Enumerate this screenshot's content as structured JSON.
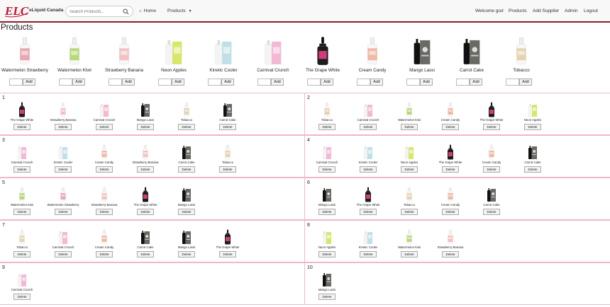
{
  "brand": {
    "logo_text": "ELC",
    "name": "eLiquid Canada"
  },
  "search": {
    "placeholder": "Search Products..."
  },
  "nav": {
    "home": "Home",
    "products": "Products",
    "welcome": "Welcome god",
    "right_products": "Products",
    "add_supplier": "Add Supplier",
    "admin": "Admin",
    "logout": "Logout"
  },
  "page_title": "Products",
  "add_label": "Add",
  "delete_label": "Delete",
  "products": [
    {
      "name": "Watermelon Strawberry",
      "key": "watermelon_strawberry"
    },
    {
      "name": "Watermelon KIwI",
      "key": "watermelon_kiwi"
    },
    {
      "name": "Strawberry Banana",
      "key": "strawberry_banana"
    },
    {
      "name": "Neon Apples",
      "key": "neon_apples"
    },
    {
      "name": "Kinetic Cooler",
      "key": "kinetic_cooler"
    },
    {
      "name": "Carnival Crunch",
      "key": "carnival_crunch"
    },
    {
      "name": "The Grape White",
      "key": "grape_white"
    },
    {
      "name": "Cream Candy",
      "key": "cream_candy"
    },
    {
      "name": "Mango Lassi",
      "key": "mango_lassi"
    },
    {
      "name": "Carrot Cake",
      "key": "carrot_cake"
    },
    {
      "name": "Tobacco",
      "key": "tobacco"
    }
  ],
  "carts": [
    {
      "number": "1",
      "items": [
        {
          "name": "The Grape White",
          "key": "grape_white"
        },
        {
          "name": "Strawberry Banana",
          "key": "strawberry_banana"
        },
        {
          "name": "Carnival Crunch",
          "key": "carnival_crunch"
        },
        {
          "name": "Mango Lassi",
          "key": "mango_lassi"
        },
        {
          "name": "Tobacco",
          "key": "tobacco"
        },
        {
          "name": "Carrot Cake",
          "key": "carrot_cake"
        }
      ]
    },
    {
      "number": "2",
      "items": [
        {
          "name": "Tobacco",
          "key": "tobacco"
        },
        {
          "name": "Carnival Crunch",
          "key": "carnival_crunch"
        },
        {
          "name": "Watermelon Kiwi",
          "key": "watermelon_kiwi"
        },
        {
          "name": "Cream Candy",
          "key": "cream_candy"
        },
        {
          "name": "The Grape White",
          "key": "grape_white"
        },
        {
          "name": "Neon Apples",
          "key": "neon_apples"
        }
      ]
    },
    {
      "number": "3",
      "items": [
        {
          "name": "Carnival Crunch",
          "key": "carnival_crunch"
        },
        {
          "name": "Kinetic Cooler",
          "key": "kinetic_cooler"
        },
        {
          "name": "Cream Candy",
          "key": "cream_candy"
        },
        {
          "name": "Strawberry Banana",
          "key": "strawberry_banana"
        },
        {
          "name": "Carrot Cake",
          "key": "carrot_cake"
        },
        {
          "name": "Tobacco",
          "key": "tobacco"
        }
      ]
    },
    {
      "number": "4",
      "items": [
        {
          "name": "Carnival Crunch",
          "key": "carnival_crunch"
        },
        {
          "name": "Kinetic Cooler",
          "key": "kinetic_cooler"
        },
        {
          "name": "Neon Apples",
          "key": "neon_apples"
        },
        {
          "name": "The Grape White",
          "key": "grape_white"
        },
        {
          "name": "Cream Candy",
          "key": "cream_candy"
        },
        {
          "name": "Carrot Cake",
          "key": "carrot_cake"
        }
      ]
    },
    {
      "number": "5",
      "items": [
        {
          "name": "Watermelon Kiwi",
          "key": "watermelon_kiwi"
        },
        {
          "name": "Watermelon Strawberry",
          "key": "watermelon_strawberry"
        },
        {
          "name": "Strawberry Banana",
          "key": "strawberry_banana"
        },
        {
          "name": "The Grape White",
          "key": "grape_white"
        },
        {
          "name": "Mango Lassi",
          "key": "mango_lassi"
        }
      ]
    },
    {
      "number": "6",
      "items": [
        {
          "name": "Mango Lassi",
          "key": "mango_lassi"
        },
        {
          "name": "The Grape White",
          "key": "grape_white"
        },
        {
          "name": "Tobacco",
          "key": "tobacco"
        },
        {
          "name": "Cream Candy",
          "key": "cream_candy"
        },
        {
          "name": "Carrot Cake",
          "key": "carrot_cake"
        }
      ]
    },
    {
      "number": "7",
      "items": [
        {
          "name": "Tobacco",
          "key": "tobacco"
        },
        {
          "name": "Carnival Crunch",
          "key": "carnival_crunch"
        },
        {
          "name": "Cream Candy",
          "key": "cream_candy"
        },
        {
          "name": "Carrot Cake",
          "key": "carrot_cake"
        },
        {
          "name": "Mango Lassi",
          "key": "mango_lassi"
        },
        {
          "name": "The Grape White",
          "key": "grape_white"
        }
      ]
    },
    {
      "number": "8",
      "items": [
        {
          "name": "Neon Apples",
          "key": "neon_apples"
        },
        {
          "name": "Kinetic Cooler",
          "key": "kinetic_cooler"
        },
        {
          "name": "Watermelon Kiwi",
          "key": "watermelon_kiwi"
        },
        {
          "name": "Strawberry Banana",
          "key": "strawberry_banana"
        }
      ]
    },
    {
      "number": "9",
      "items": [
        {
          "name": "Carnival Crunch",
          "key": "carnival_crunch"
        }
      ]
    },
    {
      "number": "10",
      "items": [
        {
          "name": "Mango Lassi",
          "key": "mango_lassi"
        }
      ]
    }
  ],
  "colors": {
    "brand_red": "#c8102e",
    "nav_border": "#8b1f2a",
    "cart_border": "#f0b8c4",
    "nav_bg": "#f8f8f8"
  },
  "icons": {
    "home": "home-icon",
    "search": "search-icon",
    "dropdown": "caret-down-icon"
  }
}
